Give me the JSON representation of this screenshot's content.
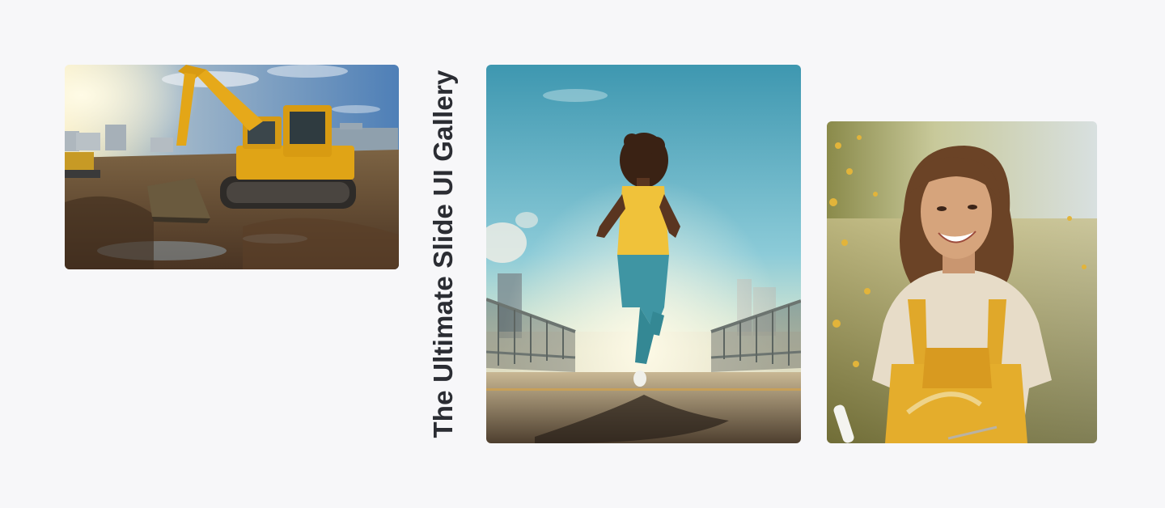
{
  "gallery": {
    "title": "The Ultimate Slide UI Gallery",
    "title_color": "#2b2d33",
    "background": "#f7f7f9",
    "slides": [
      {
        "id": "slide-1",
        "subject": "excavator-construction-site"
      },
      {
        "id": "slide-2",
        "subject": "runner-on-bridge"
      },
      {
        "id": "slide-3",
        "subject": "smiling-woman-yellow-overalls"
      }
    ]
  }
}
